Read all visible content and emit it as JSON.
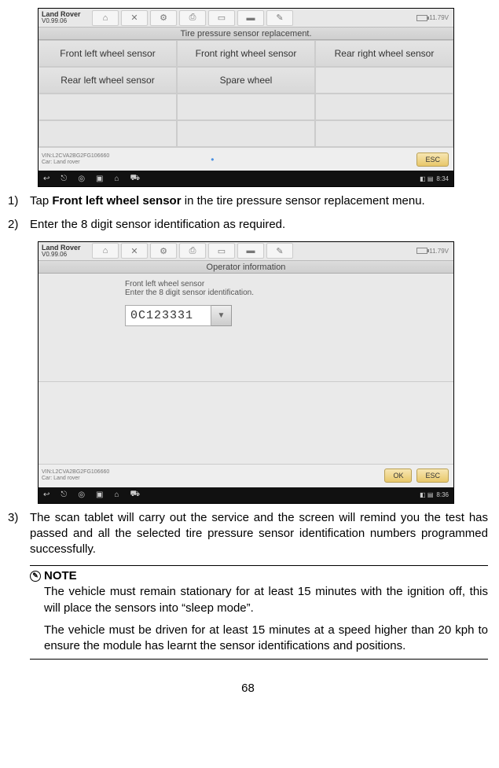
{
  "screenshot1": {
    "brand": "Land Rover",
    "version": "V0.99.06",
    "title": "Tire pressure sensor replacement.",
    "voltage": "11.79V",
    "cells": [
      "Front left wheel sensor",
      "Front right wheel sensor",
      "Rear right wheel sensor",
      "Rear left wheel sensor",
      "Spare wheel",
      "",
      "",
      "",
      "",
      "",
      "",
      ""
    ],
    "vin": "VIN:L2CVA2BG2FG106660",
    "car": "Car: Land rover",
    "esc": "ESC",
    "time": "8:34"
  },
  "step1": {
    "num": "1)",
    "pre": "Tap ",
    "bold": "Front left wheel sensor",
    "post": " in the tire pressure sensor replacement menu."
  },
  "step2": {
    "num": "2)",
    "txt": "Enter the 8 digit sensor identification as required."
  },
  "screenshot2": {
    "brand": "Land Rover",
    "version": "V0.99.06",
    "title": "Operator information",
    "voltage": "11.79V",
    "line1": "Front left wheel sensor",
    "line2": "Enter the 8 digit sensor identification.",
    "code": "0C123331",
    "vin": "VIN:L2CVA2BG2FG106660",
    "car": "Car: Land rover",
    "ok": "OK",
    "esc": "ESC",
    "time": "8:36"
  },
  "step3": {
    "num": "3)",
    "txt": "The scan tablet will carry out the service and the screen will remind you the test has passed and all the selected tire pressure sensor identification numbers programmed successfully."
  },
  "note": {
    "hdr": "NOTE",
    "p1": "The vehicle must remain stationary for at least 15 minutes with the ignition off, this will place the sensors into “sleep mode”.",
    "p2": "The vehicle must be driven for at least 15 minutes at a speed higher than 20 kph to ensure the module has learnt the sensor identifications and positions."
  },
  "pagenum": "68"
}
